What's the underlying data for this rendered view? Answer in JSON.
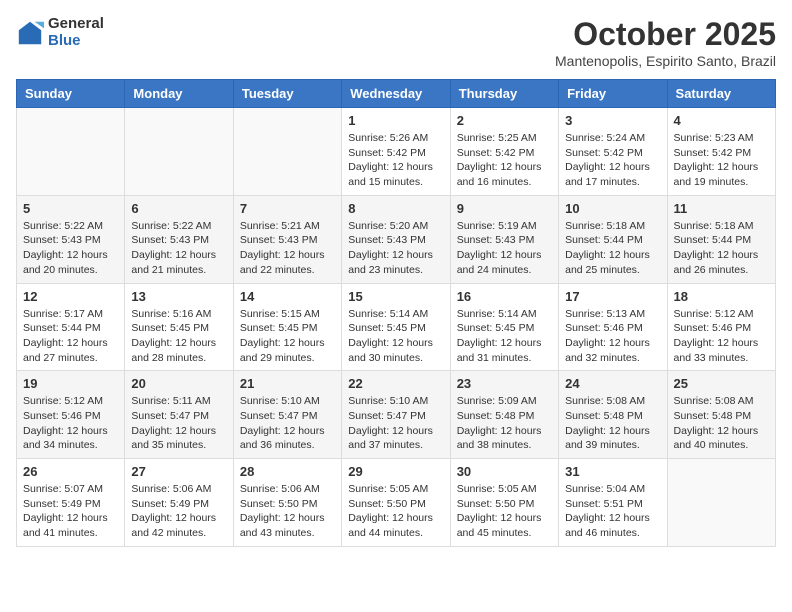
{
  "logo": {
    "general": "General",
    "blue": "Blue"
  },
  "header": {
    "month": "October 2025",
    "location": "Mantenopolis, Espirito Santo, Brazil"
  },
  "weekdays": [
    "Sunday",
    "Monday",
    "Tuesday",
    "Wednesday",
    "Thursday",
    "Friday",
    "Saturday"
  ],
  "weeks": [
    [
      {
        "day": "",
        "info": ""
      },
      {
        "day": "",
        "info": ""
      },
      {
        "day": "",
        "info": ""
      },
      {
        "day": "1",
        "info": "Sunrise: 5:26 AM\nSunset: 5:42 PM\nDaylight: 12 hours\nand 15 minutes."
      },
      {
        "day": "2",
        "info": "Sunrise: 5:25 AM\nSunset: 5:42 PM\nDaylight: 12 hours\nand 16 minutes."
      },
      {
        "day": "3",
        "info": "Sunrise: 5:24 AM\nSunset: 5:42 PM\nDaylight: 12 hours\nand 17 minutes."
      },
      {
        "day": "4",
        "info": "Sunrise: 5:23 AM\nSunset: 5:42 PM\nDaylight: 12 hours\nand 19 minutes."
      }
    ],
    [
      {
        "day": "5",
        "info": "Sunrise: 5:22 AM\nSunset: 5:43 PM\nDaylight: 12 hours\nand 20 minutes."
      },
      {
        "day": "6",
        "info": "Sunrise: 5:22 AM\nSunset: 5:43 PM\nDaylight: 12 hours\nand 21 minutes."
      },
      {
        "day": "7",
        "info": "Sunrise: 5:21 AM\nSunset: 5:43 PM\nDaylight: 12 hours\nand 22 minutes."
      },
      {
        "day": "8",
        "info": "Sunrise: 5:20 AM\nSunset: 5:43 PM\nDaylight: 12 hours\nand 23 minutes."
      },
      {
        "day": "9",
        "info": "Sunrise: 5:19 AM\nSunset: 5:43 PM\nDaylight: 12 hours\nand 24 minutes."
      },
      {
        "day": "10",
        "info": "Sunrise: 5:18 AM\nSunset: 5:44 PM\nDaylight: 12 hours\nand 25 minutes."
      },
      {
        "day": "11",
        "info": "Sunrise: 5:18 AM\nSunset: 5:44 PM\nDaylight: 12 hours\nand 26 minutes."
      }
    ],
    [
      {
        "day": "12",
        "info": "Sunrise: 5:17 AM\nSunset: 5:44 PM\nDaylight: 12 hours\nand 27 minutes."
      },
      {
        "day": "13",
        "info": "Sunrise: 5:16 AM\nSunset: 5:45 PM\nDaylight: 12 hours\nand 28 minutes."
      },
      {
        "day": "14",
        "info": "Sunrise: 5:15 AM\nSunset: 5:45 PM\nDaylight: 12 hours\nand 29 minutes."
      },
      {
        "day": "15",
        "info": "Sunrise: 5:14 AM\nSunset: 5:45 PM\nDaylight: 12 hours\nand 30 minutes."
      },
      {
        "day": "16",
        "info": "Sunrise: 5:14 AM\nSunset: 5:45 PM\nDaylight: 12 hours\nand 31 minutes."
      },
      {
        "day": "17",
        "info": "Sunrise: 5:13 AM\nSunset: 5:46 PM\nDaylight: 12 hours\nand 32 minutes."
      },
      {
        "day": "18",
        "info": "Sunrise: 5:12 AM\nSunset: 5:46 PM\nDaylight: 12 hours\nand 33 minutes."
      }
    ],
    [
      {
        "day": "19",
        "info": "Sunrise: 5:12 AM\nSunset: 5:46 PM\nDaylight: 12 hours\nand 34 minutes."
      },
      {
        "day": "20",
        "info": "Sunrise: 5:11 AM\nSunset: 5:47 PM\nDaylight: 12 hours\nand 35 minutes."
      },
      {
        "day": "21",
        "info": "Sunrise: 5:10 AM\nSunset: 5:47 PM\nDaylight: 12 hours\nand 36 minutes."
      },
      {
        "day": "22",
        "info": "Sunrise: 5:10 AM\nSunset: 5:47 PM\nDaylight: 12 hours\nand 37 minutes."
      },
      {
        "day": "23",
        "info": "Sunrise: 5:09 AM\nSunset: 5:48 PM\nDaylight: 12 hours\nand 38 minutes."
      },
      {
        "day": "24",
        "info": "Sunrise: 5:08 AM\nSunset: 5:48 PM\nDaylight: 12 hours\nand 39 minutes."
      },
      {
        "day": "25",
        "info": "Sunrise: 5:08 AM\nSunset: 5:48 PM\nDaylight: 12 hours\nand 40 minutes."
      }
    ],
    [
      {
        "day": "26",
        "info": "Sunrise: 5:07 AM\nSunset: 5:49 PM\nDaylight: 12 hours\nand 41 minutes."
      },
      {
        "day": "27",
        "info": "Sunrise: 5:06 AM\nSunset: 5:49 PM\nDaylight: 12 hours\nand 42 minutes."
      },
      {
        "day": "28",
        "info": "Sunrise: 5:06 AM\nSunset: 5:50 PM\nDaylight: 12 hours\nand 43 minutes."
      },
      {
        "day": "29",
        "info": "Sunrise: 5:05 AM\nSunset: 5:50 PM\nDaylight: 12 hours\nand 44 minutes."
      },
      {
        "day": "30",
        "info": "Sunrise: 5:05 AM\nSunset: 5:50 PM\nDaylight: 12 hours\nand 45 minutes."
      },
      {
        "day": "31",
        "info": "Sunrise: 5:04 AM\nSunset: 5:51 PM\nDaylight: 12 hours\nand 46 minutes."
      },
      {
        "day": "",
        "info": ""
      }
    ]
  ]
}
